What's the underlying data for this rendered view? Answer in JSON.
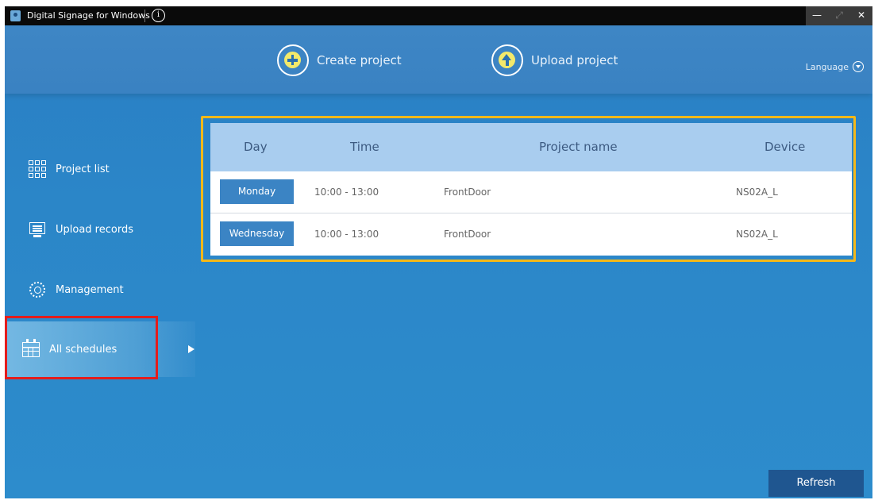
{
  "titlebar": {
    "app_title": "Digital Signage for Windows"
  },
  "header": {
    "create_label": "Create project",
    "upload_label": "Upload project",
    "language_label": "Language"
  },
  "sidebar": {
    "items": [
      {
        "label": "Project list",
        "icon": "grid-icon"
      },
      {
        "label": "Upload records",
        "icon": "monitor-icon"
      },
      {
        "label": "Management",
        "icon": "gear-icon"
      },
      {
        "label": "All schedules",
        "icon": "calendar-icon",
        "selected": true
      }
    ]
  },
  "schedule_table": {
    "headers": [
      "Day",
      "Time",
      "Project name",
      "Device"
    ],
    "rows": [
      {
        "day": "Monday",
        "time": "10:00 - 13:00",
        "project": "FrontDoor",
        "device": "NS02A_L"
      },
      {
        "day": "Wednesday",
        "time": "10:00 - 13:00",
        "project": "FrontDoor",
        "device": "NS02A_L"
      }
    ]
  },
  "footer": {
    "refresh_label": "Refresh"
  },
  "colors": {
    "accent_yellow": "#f5b818",
    "highlight_red": "#e41c1c",
    "badge_blue": "#3b84c4",
    "button_dark_blue": "#1f5690"
  }
}
